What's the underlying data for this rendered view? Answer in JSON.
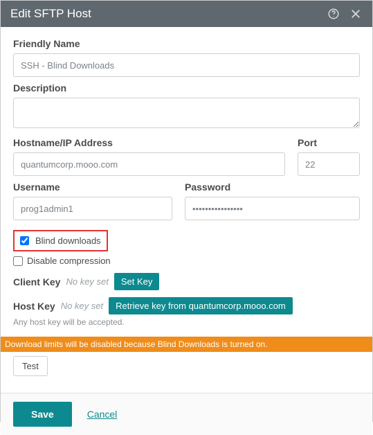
{
  "dialog": {
    "title": "Edit SFTP Host"
  },
  "labels": {
    "friendly_name": "Friendly Name",
    "description": "Description",
    "hostname": "Hostname/IP Address",
    "port": "Port",
    "username": "Username",
    "password": "Password",
    "client_key": "Client Key",
    "host_key": "Host Key"
  },
  "fields": {
    "friendly_name": "SSH - Blind Downloads",
    "description": "",
    "hostname": "quantumcorp.mooo.com",
    "port": "22",
    "username": "prog1admin1",
    "password": "••••••••••••••••"
  },
  "checkboxes": {
    "blind_downloads": {
      "label": "Blind downloads",
      "checked": true
    },
    "disable_compression": {
      "label": "Disable compression",
      "checked": false
    }
  },
  "client_key": {
    "status": "No key set",
    "button": "Set Key"
  },
  "host_key": {
    "status": "No key set",
    "button": "Retrieve key from quantumcorp.mooo.com",
    "note": "Any host key will be accepted."
  },
  "warning": "Download limits will be disabled because Blind Downloads is turned on.",
  "buttons": {
    "test": "Test",
    "save": "Save",
    "cancel": "Cancel"
  }
}
